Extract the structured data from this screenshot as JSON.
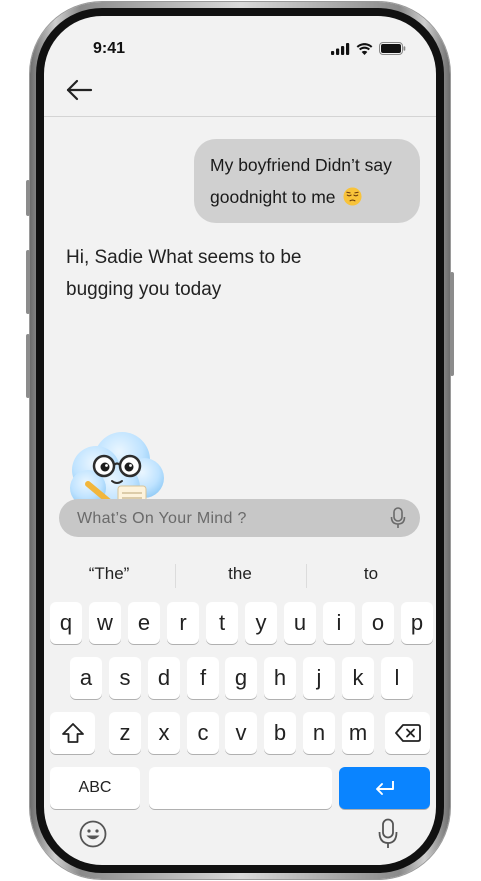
{
  "status_bar": {
    "time": "9:41"
  },
  "header": {
    "back_icon": "arrow-left-icon"
  },
  "chat": {
    "user_message": "My boyfriend Didn’t say goodnight to me",
    "user_emoji": "pensive-face-emoji",
    "bot_message": "Hi, Sadie What seems to be bugging you today"
  },
  "mascot": {
    "icon": "cloud-mascot-with-glasses"
  },
  "input": {
    "placeholder": "What’s On Your Mind ?",
    "value": "",
    "mic_icon": "microphone-icon"
  },
  "keyboard": {
    "suggestions": [
      "“The”",
      "the",
      "to"
    ],
    "row1": [
      "q",
      "w",
      "e",
      "r",
      "t",
      "y",
      "u",
      "i",
      "o",
      "p"
    ],
    "row2": [
      "a",
      "s",
      "d",
      "f",
      "g",
      "h",
      "j",
      "k",
      "l"
    ],
    "row3": [
      "z",
      "x",
      "c",
      "v",
      "b",
      "n",
      "m"
    ],
    "abc_label": "ABC",
    "space_label": "",
    "return_icon": "return-icon",
    "shift_icon": "shift-icon",
    "delete_icon": "delete-icon",
    "emoji_icon": "emoji-icon",
    "dictation_icon": "microphone-icon",
    "return_color": "#0a84ff"
  }
}
